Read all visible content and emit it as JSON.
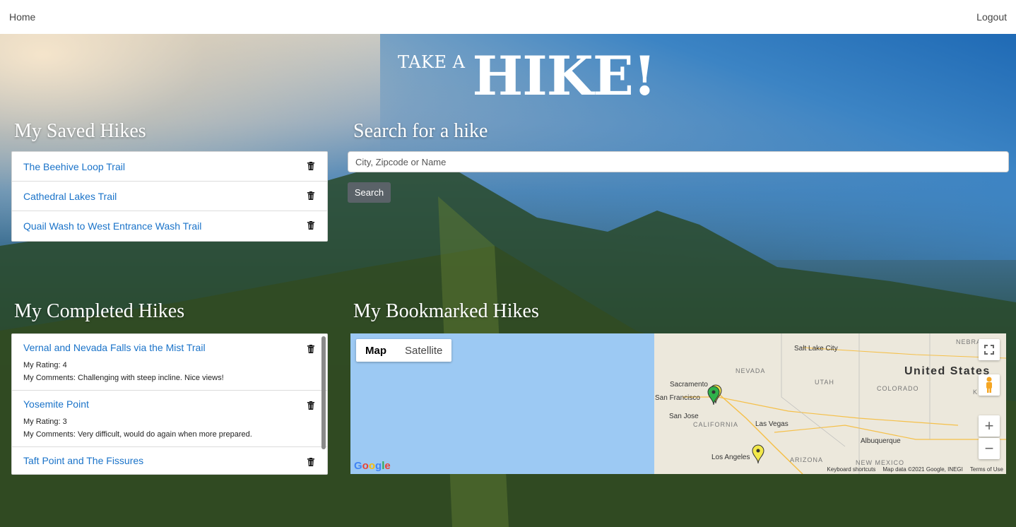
{
  "nav": {
    "home": "Home",
    "logout": "Logout"
  },
  "title": {
    "small": "TAKE A",
    "big": "HIKE!"
  },
  "saved": {
    "heading": "My Saved Hikes",
    "items": [
      {
        "name": "The Beehive Loop Trail"
      },
      {
        "name": "Cathedral Lakes Trail"
      },
      {
        "name": "Quail Wash to West Entrance Wash Trail"
      }
    ]
  },
  "search": {
    "heading": "Search for a hike",
    "placeholder": "City, Zipcode or Name",
    "button": "Search"
  },
  "completed": {
    "heading": "My Completed Hikes",
    "items": [
      {
        "name": "Vernal and Nevada Falls via the Mist Trail",
        "rating": "My Rating: 4",
        "comments": "My Comments: Challenging with steep incline. Nice views!"
      },
      {
        "name": "Yosemite Point",
        "rating": "My Rating: 3",
        "comments": "My Comments: Very difficult, would do again when more prepared."
      },
      {
        "name": "Taft Point and The Fissures",
        "rating": "",
        "comments": ""
      }
    ]
  },
  "bookmarked": {
    "heading": "My Bookmarked Hikes",
    "map_type": {
      "map": "Map",
      "satellite": "Satellite",
      "selected": "Map"
    },
    "cities": [
      "Salt Lake City",
      "Sacramento",
      "San Francisco",
      "San Jose",
      "Las Vegas",
      "Albuquerque",
      "Los Angeles"
    ],
    "states": [
      "NEVADA",
      "UTAH",
      "COLORADO",
      "CALIFORNIA",
      "ARIZONA",
      "NEW MEXICO",
      "NEBRA",
      "K"
    ],
    "country": "United States",
    "attribution": {
      "shortcuts": "Keyboard shortcuts",
      "data": "Map data ©2021 Google, INEGI",
      "terms": "Terms of Use"
    },
    "logo": "Google",
    "controls": {
      "zoom_in": "+",
      "zoom_out": "−"
    },
    "pins": [
      {
        "color": "#2fb24a"
      },
      {
        "color": "#f2e84a"
      },
      {
        "color": "#f2e84a"
      }
    ]
  }
}
